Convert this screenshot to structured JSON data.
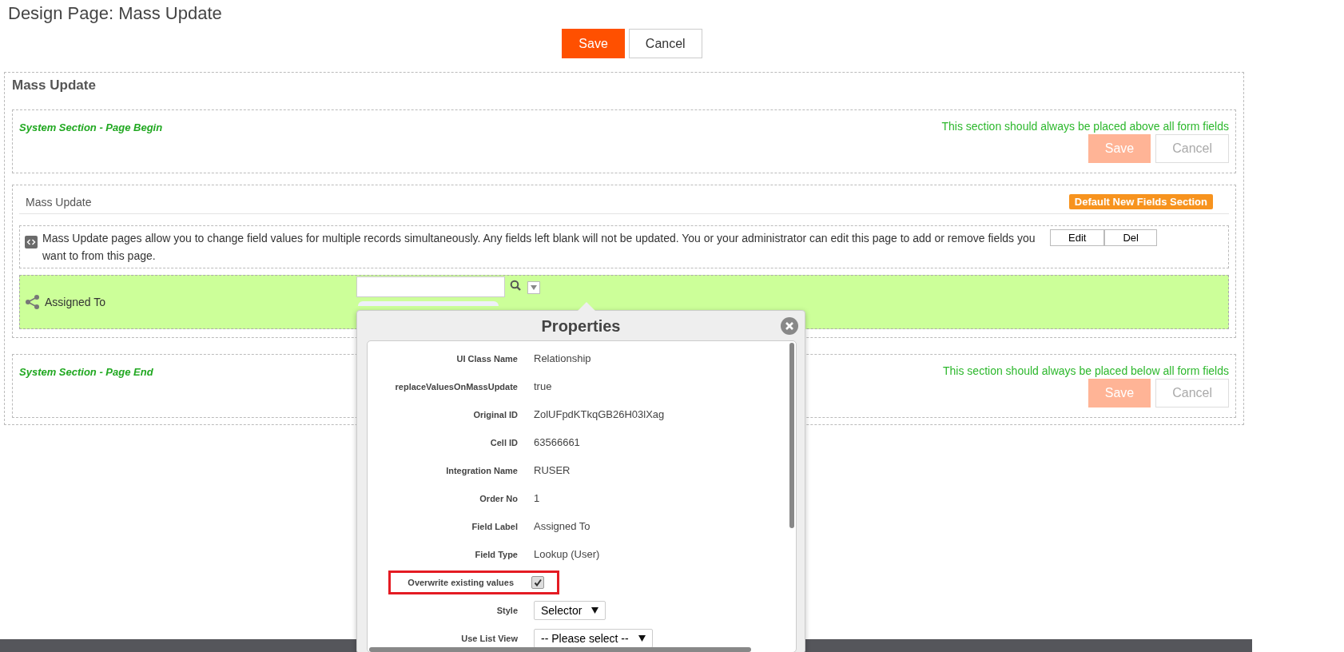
{
  "page": {
    "title": "Design Page: Mass Update"
  },
  "top_buttons": [
    {
      "label": "Save",
      "kind": "primary"
    },
    {
      "label": "Cancel",
      "kind": "secondary"
    }
  ],
  "form": {
    "title": "Mass Update",
    "sections": [
      {
        "kind": "system",
        "title": "System Section - Page Begin",
        "note": "This section should always be placed above all form fields",
        "buttons": [
          {
            "label": "Save",
            "kind": "primary",
            "disabled": true
          },
          {
            "label": "Cancel",
            "kind": "secondary",
            "disabled": true
          }
        ]
      },
      {
        "kind": "fields",
        "title": "Mass Update",
        "badge": "Default New Fields Section",
        "description": "Mass Update pages allow you to change field values for multiple records simultaneously. Any fields left blank will not be updated. You or your administrator can edit this page to add or remove fields you want to from this page.",
        "description_buttons": [
          "Edit",
          "Del"
        ],
        "field": {
          "label": "Assigned To",
          "highlighted": true
        }
      },
      {
        "kind": "system",
        "title": "System Section - Page End",
        "note": "This section should always be placed below all form fields",
        "buttons": [
          {
            "label": "Save",
            "kind": "primary",
            "disabled": true
          },
          {
            "label": "Cancel",
            "kind": "secondary",
            "disabled": true
          }
        ]
      }
    ]
  },
  "properties": {
    "title": "Properties",
    "rows": [
      {
        "kind": "text",
        "label": "UI Class Name",
        "value": "Relationship"
      },
      {
        "kind": "text",
        "label": "replaceValuesOnMassUpdate",
        "value": "true"
      },
      {
        "kind": "text",
        "label": "Original ID",
        "value": "ZolUFpdKTkqGB26H03lXag"
      },
      {
        "kind": "text",
        "label": "Cell ID",
        "value": "63566661"
      },
      {
        "kind": "text",
        "label": "Integration Name",
        "value": "RUSER"
      },
      {
        "kind": "text",
        "label": "Order No",
        "value": "1"
      },
      {
        "kind": "text",
        "label": "Field Label",
        "value": "Assigned To"
      },
      {
        "kind": "text",
        "label": "Field Type",
        "value": "Lookup (User)"
      },
      {
        "kind": "checkbox",
        "label": "Overwrite existing values",
        "checked": true,
        "highlighted": true
      },
      {
        "kind": "select",
        "label": "Style",
        "value": "Selector"
      },
      {
        "kind": "select",
        "label": "Use List View",
        "value": "-- Please select --"
      }
    ]
  }
}
